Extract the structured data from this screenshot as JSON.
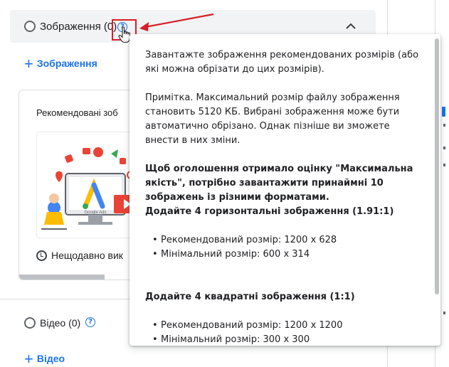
{
  "images_section": {
    "title": "Зображення (0)",
    "add_label": "Зображення",
    "recommended_title": "Рекомендовані зоб",
    "recent_label": "Нещодавно вик"
  },
  "video_section": {
    "title": "Відео (0)",
    "add_label": "Відео"
  },
  "tooltip": {
    "p1": "Завантажте зображення рекомендованих розмірів (або які можна обрізати до цих розмірів).",
    "p2": "Примітка. Максимальний розмір файлу зображення становить 5120 КБ. Вибрані зображення може бути автоматично обрізано. Однак пізніше ви зможете внести в них зміни.",
    "p3": "Щоб оголошення отримало оцінку \"Максимальна якість\", потрібно завантажити принаймні 10 зображень із різними форматами.",
    "horizontal_heading": "Додайте 4 горизонтальні зображення (1.91:1)",
    "horizontal_items": [
      "Рекомендований розмір: 1200 x 628",
      "Мінімальний розмір: 600 x 314"
    ],
    "square_heading": "Додайте 4 квадратні зображення (1:1)",
    "square_items": [
      "Рекомендований розмір: 1200 x 1200",
      "Мінімальний розмір: 300 x 300"
    ]
  },
  "illustration_text": "Google Ads",
  "icons": {
    "help": "help-circle-icon",
    "collapse": "chevron-up-icon",
    "add": "plus-icon",
    "recent": "history-icon",
    "cursor": "hand-pointer-icon",
    "callout": "red-arrow"
  },
  "colors": {
    "accent": "#1a73e8",
    "highlight": "#d51f26",
    "header_bg": "#f1f3f4"
  }
}
